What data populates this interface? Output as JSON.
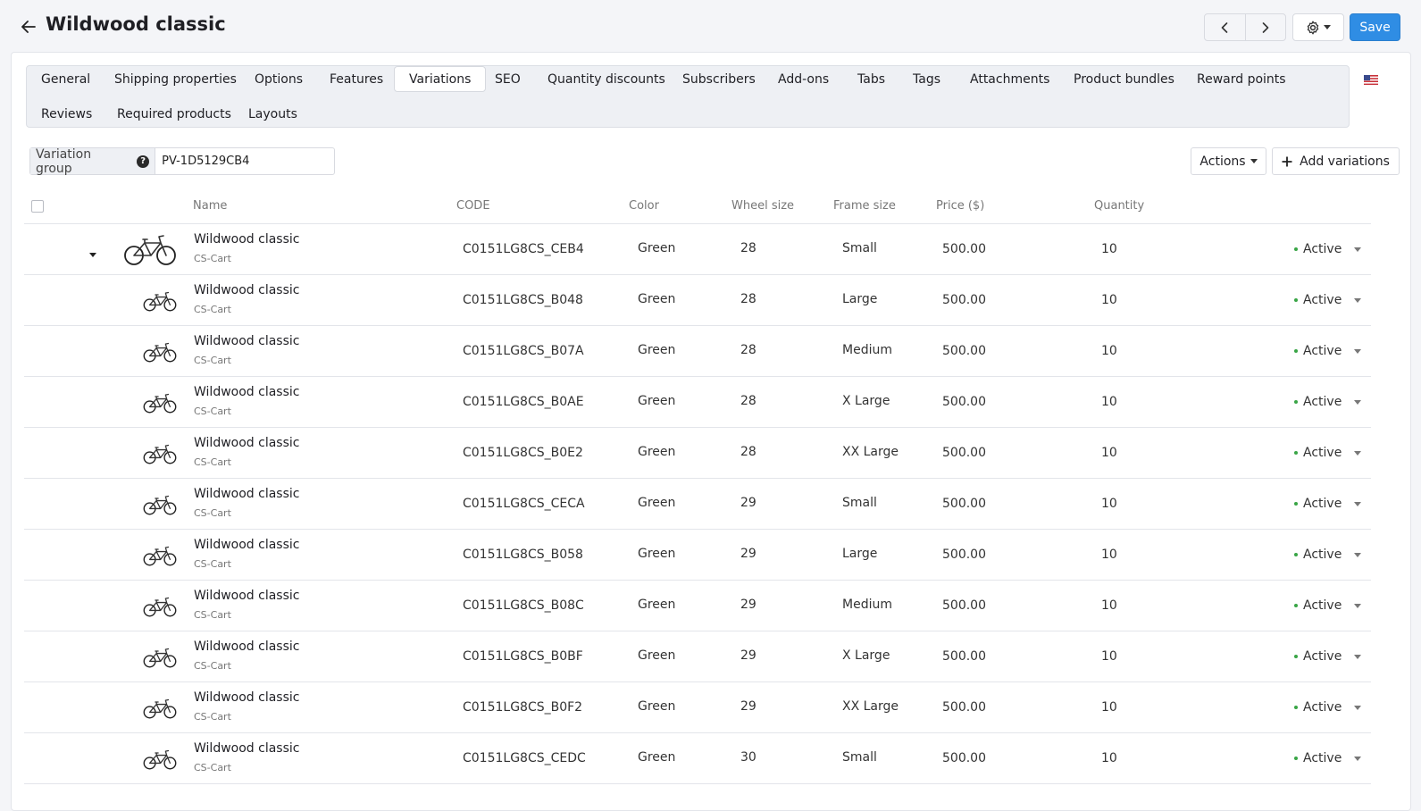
{
  "header": {
    "title": "Wildwood classic",
    "save_label": "Save"
  },
  "tabs": [
    {
      "label": "General"
    },
    {
      "label": "Shipping properties"
    },
    {
      "label": "Options"
    },
    {
      "label": "Features"
    },
    {
      "label": "Variations",
      "active": true
    },
    {
      "label": "SEO"
    },
    {
      "label": "Quantity discounts"
    },
    {
      "label": "Subscribers"
    },
    {
      "label": "Add-ons"
    },
    {
      "label": "Tabs"
    },
    {
      "label": "Tags"
    },
    {
      "label": "Attachments"
    },
    {
      "label": "Product bundles"
    },
    {
      "label": "Reward points"
    },
    {
      "label": "Reviews"
    },
    {
      "label": "Required products"
    },
    {
      "label": "Layouts"
    }
  ],
  "variation_group": {
    "label": "Variation group",
    "value": "PV-1D5129CB4"
  },
  "toolbar": {
    "actions_label": "Actions",
    "add_variations_label": "Add variations"
  },
  "table": {
    "columns": {
      "name": "Name",
      "code": "CODE",
      "color": "Color",
      "wheel": "Wheel size",
      "frame": "Frame size",
      "price": "Price ($)",
      "quantity": "Quantity"
    },
    "rows": [
      {
        "name": "Wildwood classic",
        "vendor": "CS-Cart",
        "code": "C0151LG8CS_CEB4",
        "color": "Green",
        "wheel": "28",
        "frame": "Small",
        "price": "500.00",
        "qty": "10",
        "status": "Active"
      },
      {
        "name": "Wildwood classic",
        "vendor": "CS-Cart",
        "code": "C0151LG8CS_B048",
        "color": "Green",
        "wheel": "28",
        "frame": "Large",
        "price": "500.00",
        "qty": "10",
        "status": "Active"
      },
      {
        "name": "Wildwood classic",
        "vendor": "CS-Cart",
        "code": "C0151LG8CS_B07A",
        "color": "Green",
        "wheel": "28",
        "frame": "Medium",
        "price": "500.00",
        "qty": "10",
        "status": "Active"
      },
      {
        "name": "Wildwood classic",
        "vendor": "CS-Cart",
        "code": "C0151LG8CS_B0AE",
        "color": "Green",
        "wheel": "28",
        "frame": "X Large",
        "price": "500.00",
        "qty": "10",
        "status": "Active"
      },
      {
        "name": "Wildwood classic",
        "vendor": "CS-Cart",
        "code": "C0151LG8CS_B0E2",
        "color": "Green",
        "wheel": "28",
        "frame": "XX Large",
        "price": "500.00",
        "qty": "10",
        "status": "Active"
      },
      {
        "name": "Wildwood classic",
        "vendor": "CS-Cart",
        "code": "C0151LG8CS_CECA",
        "color": "Green",
        "wheel": "29",
        "frame": "Small",
        "price": "500.00",
        "qty": "10",
        "status": "Active"
      },
      {
        "name": "Wildwood classic",
        "vendor": "CS-Cart",
        "code": "C0151LG8CS_B058",
        "color": "Green",
        "wheel": "29",
        "frame": "Large",
        "price": "500.00",
        "qty": "10",
        "status": "Active"
      },
      {
        "name": "Wildwood classic",
        "vendor": "CS-Cart",
        "code": "C0151LG8CS_B08C",
        "color": "Green",
        "wheel": "29",
        "frame": "Medium",
        "price": "500.00",
        "qty": "10",
        "status": "Active"
      },
      {
        "name": "Wildwood classic",
        "vendor": "CS-Cart",
        "code": "C0151LG8CS_B0BF",
        "color": "Green",
        "wheel": "29",
        "frame": "X Large",
        "price": "500.00",
        "qty": "10",
        "status": "Active"
      },
      {
        "name": "Wildwood classic",
        "vendor": "CS-Cart",
        "code": "C0151LG8CS_B0F2",
        "color": "Green",
        "wheel": "29",
        "frame": "XX Large",
        "price": "500.00",
        "qty": "10",
        "status": "Active"
      },
      {
        "name": "Wildwood classic",
        "vendor": "CS-Cart",
        "code": "C0151LG8CS_CEDC",
        "color": "Green",
        "wheel": "30",
        "frame": "Small",
        "price": "500.00",
        "qty": "10",
        "status": "Active"
      }
    ]
  },
  "colors": {
    "accent": "#2f8de4",
    "status_active": "#39a546"
  }
}
